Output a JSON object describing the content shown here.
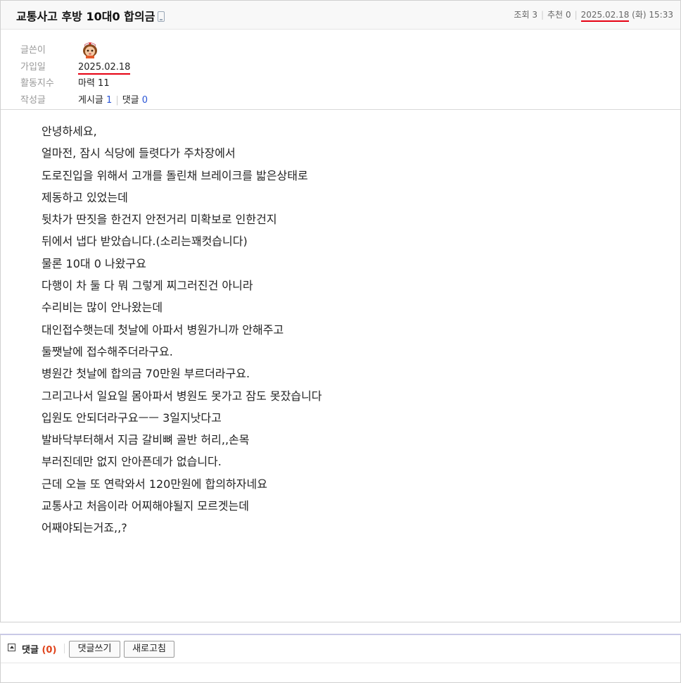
{
  "post": {
    "title": "교통사고 후방 10대0 합의금",
    "meta": {
      "views_label": "조회",
      "views": "3",
      "recommend_label": "추천",
      "recommend": "0",
      "date": "2025.02.18",
      "weekday": "(화)",
      "time": "15:33"
    }
  },
  "writer": {
    "author_label": "글쓴이",
    "joined_label": "가입일",
    "joined_date": "2025.02.18",
    "activity_label": "활동지수",
    "activity_value": "마력 11",
    "posts_label": "작성글",
    "posts_text": "게시글",
    "posts_count": "1",
    "replies_text": "댓글",
    "replies_count": "0"
  },
  "content": {
    "lines": [
      "안녕하세요,",
      "얼마전, 잠시 식당에 들렷다가 주차장에서",
      "도로진입을 위해서 고개를 돌린채 브레이크를 밟은상태로",
      "제동하고 있었는데",
      "뒷차가 딴짓을 한건지 안전거리 미확보로 인한건지",
      "뒤에서 냅다 받았습니다.(소리는꽤컷습니다)",
      "물론 10대 0 나왔구요",
      "다행이 차 둘 다 뭐 그렇게 찌그러진건 아니라",
      "수리비는 많이 안나왔는데",
      "대인접수햇는데 첫날에 아파서 병원가니까 안해주고",
      "둘쨋날에 접수해주더라구요.",
      "병원간 첫날에 합의금 70만원 부르더라구요.",
      "그리고나서 일요일 몸아파서 병원도 못가고 잠도 못잤습니다",
      "입원도 안되더라구요ㅡㅡ 3일지낫다고",
      "발바닥부터해서 지금 갈비뼈 골반 허리,,손목",
      "부러진데만 없지 안아픈데가 없습니다.",
      "근데 오늘 또 연락와서 120만원에 합의하자네요",
      "교통사고 처음이라 어찌해야될지 모르겟는데",
      "어째야되는거죠,,?"
    ]
  },
  "comments": {
    "label": "댓글",
    "count": "(0)",
    "write_button": "댓글쓰기",
    "refresh_button": "새로고침"
  },
  "colors": {
    "underline": "#e60012",
    "link_blue": "#2a55d6",
    "count_orange": "#e0441c"
  }
}
